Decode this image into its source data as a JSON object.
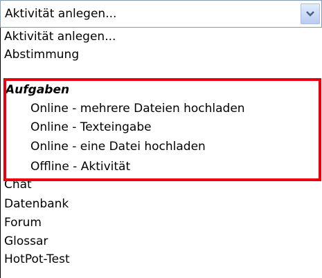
{
  "select": {
    "value": "Aktivität anlegen...",
    "arrow_icon": "chevron-down-icon"
  },
  "options": [
    {
      "label": "Aktivität anlegen...",
      "kind": "item"
    },
    {
      "label": "Abstimmung",
      "kind": "item"
    },
    {
      "label": "Aufgaben",
      "kind": "group"
    },
    {
      "label": "Online - mehrere Dateien hochladen",
      "kind": "child"
    },
    {
      "label": "Online - Texteingabe",
      "kind": "child"
    },
    {
      "label": "Online - eine Datei hochladen",
      "kind": "child"
    },
    {
      "label": "Offline - Aktivität",
      "kind": "child"
    },
    {
      "label": "Chat",
      "kind": "item"
    },
    {
      "label": "Datenbank",
      "kind": "item"
    },
    {
      "label": "Forum",
      "kind": "item"
    },
    {
      "label": "Glossar",
      "kind": "item"
    },
    {
      "label": "HotPot-Test",
      "kind": "item"
    }
  ],
  "colors": {
    "highlight_border": "#e8000c",
    "select_border": "#7f9db9"
  }
}
